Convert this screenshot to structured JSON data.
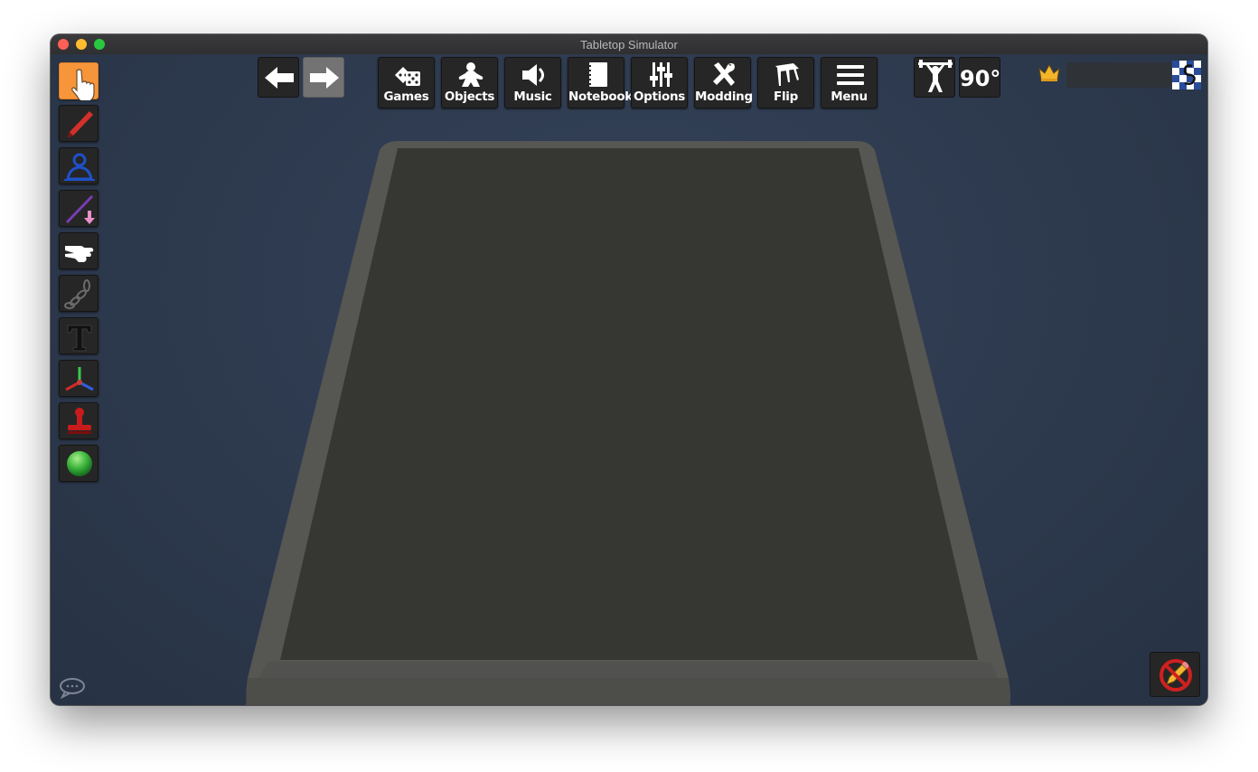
{
  "window": {
    "title": "Tabletop Simulator"
  },
  "toolbar": {
    "buttons": [
      {
        "label": "Games",
        "icon": "dice-icon"
      },
      {
        "label": "Objects",
        "icon": "meeple-icon"
      },
      {
        "label": "Music",
        "icon": "speaker-icon"
      },
      {
        "label": "Notebook",
        "icon": "notebook-icon"
      },
      {
        "label": "Options",
        "icon": "sliders-icon"
      },
      {
        "label": "Modding",
        "icon": "tools-icon"
      },
      {
        "label": "Flip",
        "icon": "flip-table-icon"
      },
      {
        "label": "Menu",
        "icon": "hamburger-icon"
      }
    ],
    "rotation_label": "90°"
  },
  "left_tools": [
    {
      "name": "grab-tool",
      "icon": "pointer-hand-icon",
      "active": true
    },
    {
      "name": "draw-tool",
      "icon": "marker-icon"
    },
    {
      "name": "zone-tool",
      "icon": "person-zone-icon"
    },
    {
      "name": "line-tool",
      "icon": "line-measure-icon"
    },
    {
      "name": "flick-tool",
      "icon": "flick-hand-icon"
    },
    {
      "name": "joint-tool",
      "icon": "chain-icon"
    },
    {
      "name": "text-tool",
      "icon": "text-t-icon"
    },
    {
      "name": "gizmo-tool",
      "icon": "axes-gizmo-icon"
    },
    {
      "name": "snap-tool",
      "icon": "stamp-icon"
    },
    {
      "name": "color-tool",
      "icon": "green-ball-icon"
    }
  ],
  "colors": {
    "active_tool": "#f7953a",
    "table_surface": "#363632",
    "table_rim": "#565653",
    "background": "#2c3748"
  }
}
